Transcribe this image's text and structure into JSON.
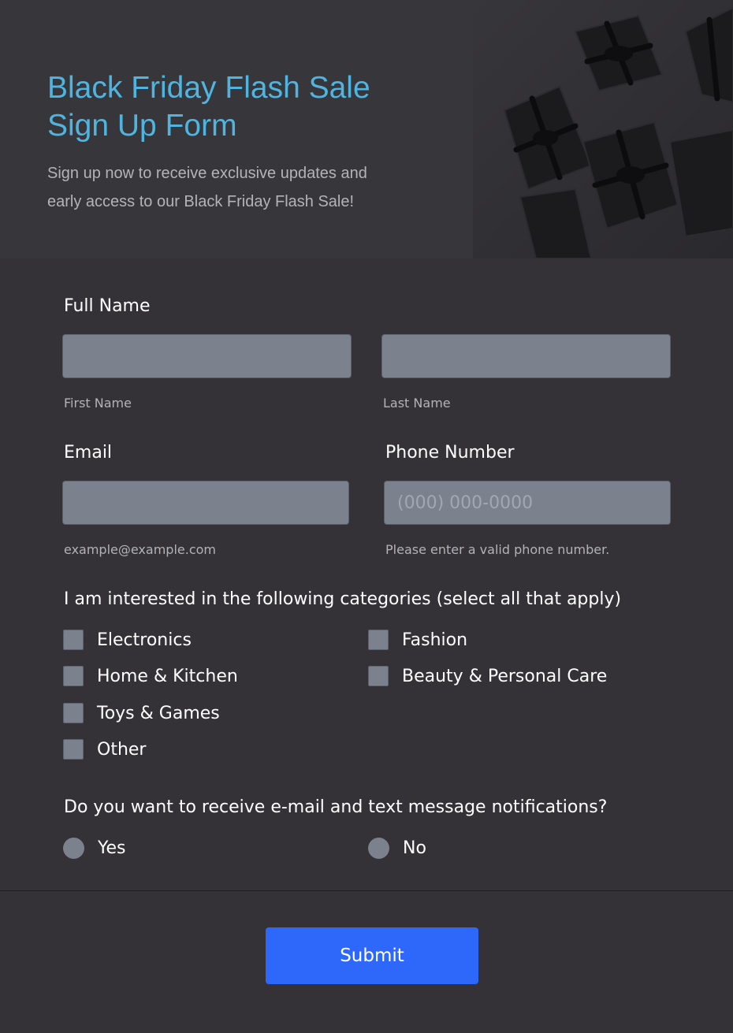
{
  "header": {
    "title_line1": "Black Friday Flash Sale",
    "title_line2": "Sign Up Form",
    "subtitle_line1": "Sign up now to receive exclusive updates and",
    "subtitle_line2": "early access to our Black Friday Flash Sale!",
    "image": "black-gift-boxes-image"
  },
  "full_name": {
    "label": "Full Name",
    "first_sublabel": "First Name",
    "last_sublabel": "Last Name",
    "first_value": "",
    "last_value": ""
  },
  "email": {
    "label": "Email",
    "value": "",
    "sublabel": "example@example.com"
  },
  "phone": {
    "label": "Phone Number",
    "placeholder": "(000) 000-0000",
    "sublabel": "Please enter a valid phone number."
  },
  "categories": {
    "question": "I am interested in the following categories (select all that apply)",
    "options": [
      "Electronics",
      "Fashion",
      "Home & Kitchen",
      "Beauty & Personal Care",
      "Toys & Games",
      "Other"
    ]
  },
  "notifications": {
    "question": "Do you want to receive e-mail and text message notifications?",
    "options": [
      "Yes",
      "No"
    ]
  },
  "submit_label": "Submit",
  "colors": {
    "title": "#4fb5e0",
    "background": "#343236",
    "input": "#7c818e",
    "button": "#2e68fb"
  }
}
